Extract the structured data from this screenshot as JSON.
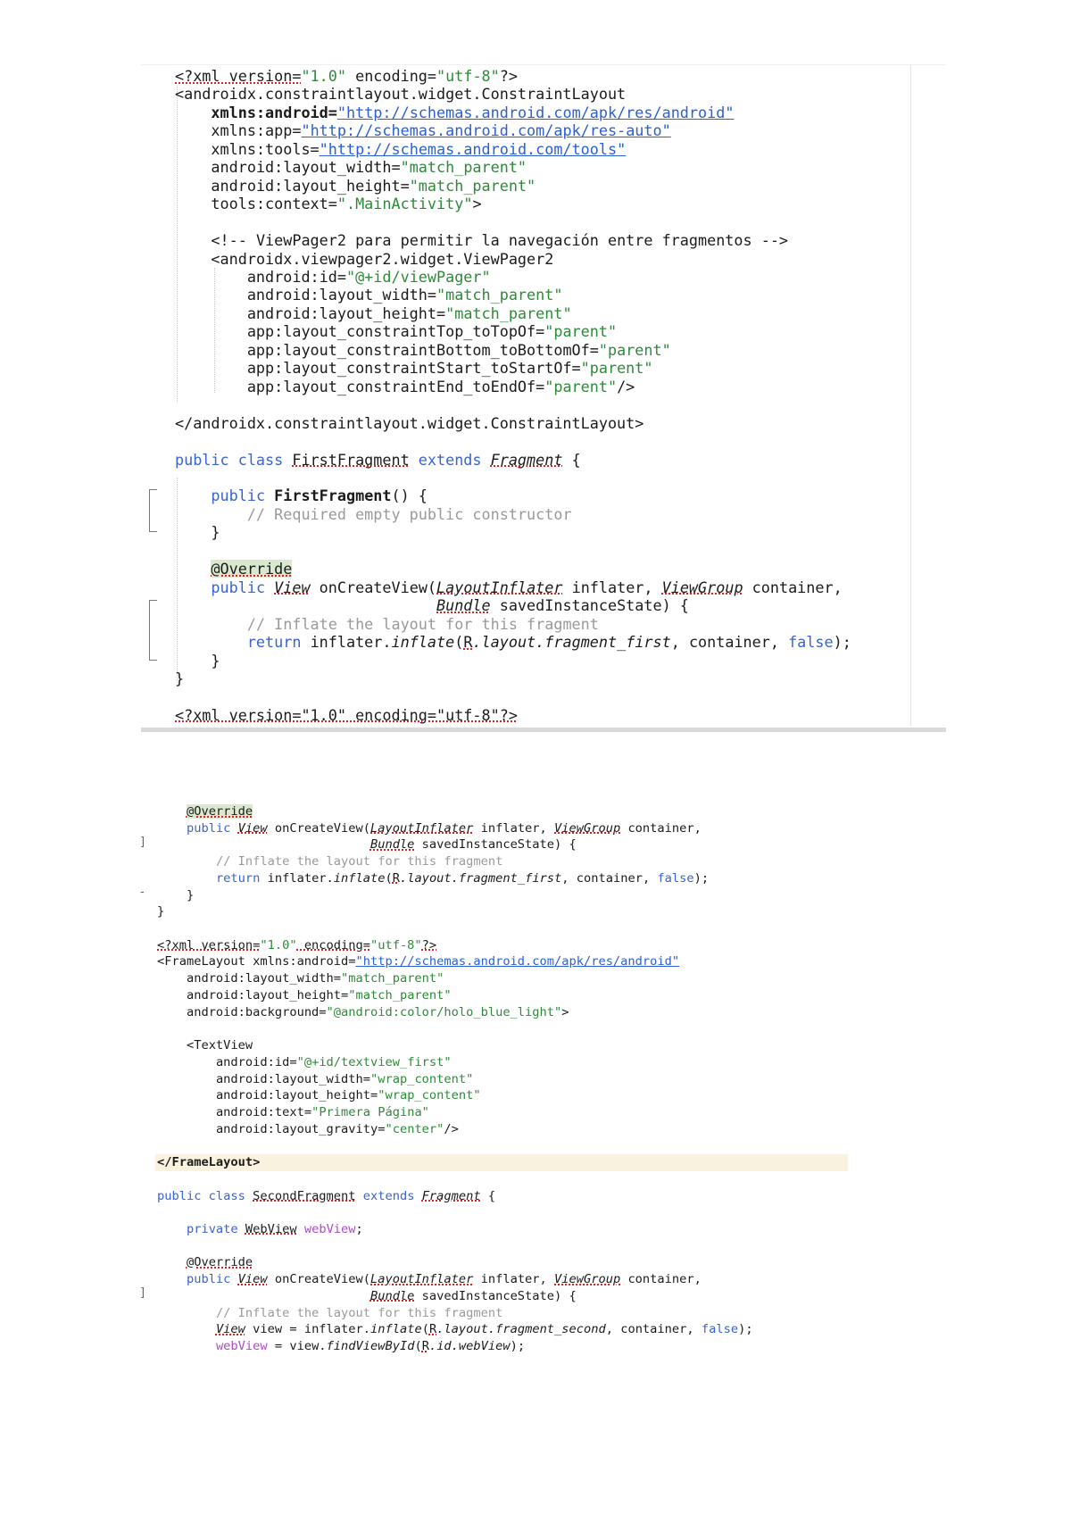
{
  "blocks": [
    {
      "lines": [
        {
          "indent": 0,
          "tokens": [
            [
              "<?xml version=",
              "e"
            ],
            [
              "\"1.0\"",
              "s"
            ],
            [
              " encoding=",
              ""
            ],
            [
              "\"utf-8\"",
              "s"
            ],
            [
              "?>",
              ""
            ]
          ]
        },
        {
          "indent": 0,
          "tokens": [
            [
              "<androidx.constraintlayout.widget.ConstraintLayout",
              ""
            ]
          ]
        },
        {
          "indent": 1,
          "tokens": [
            [
              "xmlns:android=",
              "b"
            ],
            [
              "\"",
              "u"
            ],
            [
              "http://schemas.android.com/apk/res/android",
              "u"
            ],
            [
              "\"",
              "u"
            ]
          ]
        },
        {
          "indent": 1,
          "tokens": [
            [
              "xmlns:app=",
              ""
            ],
            [
              "\"",
              "u"
            ],
            [
              "http://schemas.android.com/apk/res-auto",
              "u"
            ],
            [
              "\"",
              "u"
            ]
          ]
        },
        {
          "indent": 1,
          "tokens": [
            [
              "xmlns:tools=",
              ""
            ],
            [
              "\"",
              "u"
            ],
            [
              "http://schemas.android.com/tools",
              "u"
            ],
            [
              "\"",
              "u"
            ]
          ]
        },
        {
          "indent": 1,
          "tokens": [
            [
              "android:layout_width=",
              ""
            ],
            [
              "\"match_parent\"",
              "s"
            ]
          ]
        },
        {
          "indent": 1,
          "tokens": [
            [
              "android:layout_height=",
              ""
            ],
            [
              "\"match_parent\"",
              "s"
            ]
          ]
        },
        {
          "indent": 1,
          "tokens": [
            [
              "tools:context=",
              ""
            ],
            [
              "\".MainActivity\"",
              "s"
            ],
            [
              ">",
              ""
            ]
          ]
        },
        {
          "indent": 0,
          "tokens": []
        },
        {
          "indent": 1,
          "tokens": [
            [
              "<!-- ViewPager2 para permitir la navegación entre fragmentos -->",
              ""
            ]
          ]
        },
        {
          "indent": 1,
          "tokens": [
            [
              "<androidx.viewpager2.widget.ViewPager2",
              ""
            ]
          ]
        },
        {
          "indent": 2,
          "tokens": [
            [
              "android:id=",
              ""
            ],
            [
              "\"@+id/viewPager\"",
              "s"
            ]
          ]
        },
        {
          "indent": 2,
          "tokens": [
            [
              "android:layout_width=",
              ""
            ],
            [
              "\"match_parent\"",
              "s"
            ]
          ]
        },
        {
          "indent": 2,
          "tokens": [
            [
              "android:layout_height=",
              ""
            ],
            [
              "\"match_parent\"",
              "s"
            ]
          ]
        },
        {
          "indent": 2,
          "tokens": [
            [
              "app:layout_constraintTop_toTopOf=",
              ""
            ],
            [
              "\"parent\"",
              "s"
            ]
          ]
        },
        {
          "indent": 2,
          "tokens": [
            [
              "app:layout_constraintBottom_toBottomOf=",
              ""
            ],
            [
              "\"parent\"",
              "s"
            ]
          ]
        },
        {
          "indent": 2,
          "tokens": [
            [
              "app:layout_constraintStart_toStartOf=",
              ""
            ],
            [
              "\"parent\"",
              "s"
            ]
          ]
        },
        {
          "indent": 2,
          "tokens": [
            [
              "app:layout_constraintEnd_toEndOf=",
              ""
            ],
            [
              "\"parent\"",
              "s"
            ],
            [
              "/>",
              ""
            ]
          ]
        },
        {
          "indent": 0,
          "tokens": []
        },
        {
          "indent": 0,
          "tokens": [
            [
              "</androidx.constraintlayout.widget.ConstraintLayout>",
              ""
            ]
          ]
        },
        {
          "indent": 0,
          "tokens": []
        },
        {
          "indent": 0,
          "tokens": [
            [
              "public class ",
              "k"
            ],
            [
              "FirstFragment",
              "e"
            ],
            [
              " extends ",
              "k"
            ],
            [
              "Fragment",
              "ei"
            ],
            [
              " {",
              ""
            ]
          ]
        },
        {
          "indent": 0,
          "tokens": []
        },
        {
          "indent": 1,
          "tokens": [
            [
              "public ",
              "k"
            ],
            [
              "FirstFragment",
              "b"
            ],
            [
              "() {",
              ""
            ]
          ]
        },
        {
          "indent": 2,
          "tokens": [
            [
              "// Required empty public constructor",
              "c"
            ]
          ]
        },
        {
          "indent": 1,
          "tokens": [
            [
              "}",
              ""
            ]
          ]
        },
        {
          "indent": 0,
          "tokens": []
        },
        {
          "indent": 1,
          "tokens": [
            [
              "@Override",
              "a"
            ]
          ]
        },
        {
          "indent": 1,
          "tokens": [
            [
              "public ",
              "k"
            ],
            [
              "View",
              "ei"
            ],
            [
              " onCreateView(",
              ""
            ],
            [
              "LayoutInflater",
              "ei"
            ],
            [
              " inflater, ",
              ""
            ],
            [
              "ViewGroup",
              "ei"
            ],
            [
              " container,",
              ""
            ]
          ]
        },
        {
          "indent": 0,
          "pad": 29,
          "tokens": [
            [
              "Bundle",
              "ei"
            ],
            [
              " savedInstanceState) {",
              ""
            ]
          ]
        },
        {
          "indent": 2,
          "tokens": [
            [
              "// Inflate the layout for this fragment",
              "c"
            ]
          ]
        },
        {
          "indent": 2,
          "tokens": [
            [
              "return ",
              "k"
            ],
            [
              "inflater.",
              ""
            ],
            [
              "inflate",
              "i"
            ],
            [
              "(",
              ""
            ],
            [
              "R",
              "e"
            ],
            [
              ".layout.",
              "i"
            ],
            [
              "fragment_first",
              "i"
            ],
            [
              ", container, ",
              ""
            ],
            [
              "false",
              "k"
            ],
            [
              ");",
              ""
            ]
          ]
        },
        {
          "indent": 1,
          "tokens": [
            [
              "}",
              ""
            ]
          ]
        },
        {
          "indent": 0,
          "tokens": [
            [
              "}",
              ""
            ]
          ]
        },
        {
          "indent": 0,
          "tokens": []
        },
        {
          "indent": 0,
          "tokens": [
            [
              "<?xml version=\"1.0\" encoding=\"utf-8\"?>",
              "e"
            ]
          ]
        }
      ]
    },
    {
      "lines": [
        {
          "indent": 1,
          "tokens": [
            [
              "@Override",
              "a"
            ]
          ]
        },
        {
          "indent": 1,
          "tokens": [
            [
              "public ",
              "k"
            ],
            [
              "View",
              "ei"
            ],
            [
              " onCreateView(",
              ""
            ],
            [
              "LayoutInflater",
              "ei"
            ],
            [
              " inflater, ",
              ""
            ],
            [
              "ViewGroup",
              "ei"
            ],
            [
              " container,",
              ""
            ]
          ]
        },
        {
          "indent": 0,
          "pad": 29,
          "tokens": [
            [
              "Bundle",
              "ei"
            ],
            [
              " savedInstanceState) {",
              ""
            ]
          ]
        },
        {
          "indent": 2,
          "tokens": [
            [
              "// Inflate the layout for this fragment",
              "c"
            ]
          ]
        },
        {
          "indent": 2,
          "tokens": [
            [
              "return ",
              "k"
            ],
            [
              "inflater.",
              ""
            ],
            [
              "inflate",
              "i"
            ],
            [
              "(",
              ""
            ],
            [
              "R",
              "e"
            ],
            [
              ".layout.",
              "i"
            ],
            [
              "fragment_first",
              "i"
            ],
            [
              ", container, ",
              ""
            ],
            [
              "false",
              "k"
            ],
            [
              ");",
              ""
            ]
          ]
        },
        {
          "indent": 1,
          "tokens": [
            [
              "}",
              ""
            ]
          ]
        },
        {
          "indent": 0,
          "tokens": [
            [
              "}",
              ""
            ]
          ]
        },
        {
          "indent": 0,
          "tokens": []
        },
        {
          "indent": 0,
          "tokens": [
            [
              "<?xml version=",
              "e"
            ],
            [
              "\"1.0\"",
              "s"
            ],
            [
              " encoding=",
              "e"
            ],
            [
              "\"utf-8\"",
              "s"
            ],
            [
              "?>",
              "e"
            ]
          ]
        },
        {
          "indent": 0,
          "tokens": [
            [
              "<FrameLayout xmlns:android=",
              ""
            ],
            [
              "\"",
              "u"
            ],
            [
              "http://schemas.android.com/apk/res/android",
              "u"
            ],
            [
              "\"",
              "u"
            ]
          ]
        },
        {
          "indent": 1,
          "tokens": [
            [
              "android:layout_width=",
              ""
            ],
            [
              "\"match_parent\"",
              "s"
            ]
          ]
        },
        {
          "indent": 1,
          "tokens": [
            [
              "android:layout_height=",
              ""
            ],
            [
              "\"match_parent\"",
              "s"
            ]
          ]
        },
        {
          "indent": 1,
          "tokens": [
            [
              "android:background=",
              ""
            ],
            [
              "\"@android:color/holo_blue_light\"",
              "s"
            ],
            [
              ">",
              ""
            ]
          ]
        },
        {
          "indent": 0,
          "tokens": []
        },
        {
          "indent": 1,
          "tokens": [
            [
              "<TextView",
              ""
            ]
          ]
        },
        {
          "indent": 2,
          "tokens": [
            [
              "android:id=",
              ""
            ],
            [
              "\"@+id/textview_first\"",
              "s"
            ]
          ]
        },
        {
          "indent": 2,
          "tokens": [
            [
              "android:layout_width=",
              ""
            ],
            [
              "\"wrap_content\"",
              "s"
            ]
          ]
        },
        {
          "indent": 2,
          "tokens": [
            [
              "android:layout_height=",
              ""
            ],
            [
              "\"wrap_content\"",
              "s"
            ]
          ]
        },
        {
          "indent": 2,
          "tokens": [
            [
              "android:text=",
              ""
            ],
            [
              "\"Primera Página\"",
              "s"
            ]
          ]
        },
        {
          "indent": 2,
          "tokens": [
            [
              "android:layout_gravity=",
              ""
            ],
            [
              "\"center\"",
              "s"
            ],
            [
              "/>",
              ""
            ]
          ]
        },
        {
          "indent": 0,
          "tokens": []
        },
        {
          "indent": 0,
          "highlight": true,
          "tokens": [
            [
              "</FrameLayout>",
              "b"
            ]
          ]
        },
        {
          "indent": 0,
          "tokens": []
        },
        {
          "indent": 0,
          "tokens": [
            [
              "public class ",
              "k"
            ],
            [
              "SecondFragment",
              "e"
            ],
            [
              " extends ",
              "k"
            ],
            [
              "Fragment",
              "ei"
            ],
            [
              " {",
              ""
            ]
          ]
        },
        {
          "indent": 0,
          "tokens": []
        },
        {
          "indent": 1,
          "tokens": [
            [
              "private ",
              "k"
            ],
            [
              "WebView",
              "e"
            ],
            [
              " ",
              ""
            ],
            [
              "webView",
              "p"
            ],
            [
              ";",
              ""
            ]
          ]
        },
        {
          "indent": 0,
          "tokens": []
        },
        {
          "indent": 1,
          "tokens": [
            [
              "@Override",
              "e"
            ]
          ]
        },
        {
          "indent": 1,
          "tokens": [
            [
              "public ",
              "k"
            ],
            [
              "View",
              "ei"
            ],
            [
              " onCreateView(",
              ""
            ],
            [
              "LayoutInflater",
              "ei"
            ],
            [
              " inflater, ",
              ""
            ],
            [
              "ViewGroup",
              "ei"
            ],
            [
              " container,",
              ""
            ]
          ]
        },
        {
          "indent": 0,
          "pad": 29,
          "tokens": [
            [
              "Bundle",
              "ei"
            ],
            [
              " savedInstanceState) {",
              ""
            ]
          ]
        },
        {
          "indent": 2,
          "tokens": [
            [
              "// Inflate the layout for this fragment",
              "c"
            ]
          ]
        },
        {
          "indent": 2,
          "tokens": [
            [
              "View",
              "ei"
            ],
            [
              " view = inflater.",
              ""
            ],
            [
              "inflate",
              "i"
            ],
            [
              "(",
              ""
            ],
            [
              "R",
              "e"
            ],
            [
              ".layout.",
              "i"
            ],
            [
              "fragment_second",
              "i"
            ],
            [
              ", container, ",
              ""
            ],
            [
              "false",
              "k"
            ],
            [
              ");",
              ""
            ]
          ]
        },
        {
          "indent": 2,
          "tokens": [
            [
              "webView",
              "p"
            ],
            [
              " = view.",
              ""
            ],
            [
              "findViewById",
              "i"
            ],
            [
              "(",
              ""
            ],
            [
              "R",
              "e"
            ],
            [
              ".id.",
              "i"
            ],
            [
              "webView",
              "i"
            ],
            [
              ");",
              ""
            ]
          ]
        }
      ]
    }
  ]
}
